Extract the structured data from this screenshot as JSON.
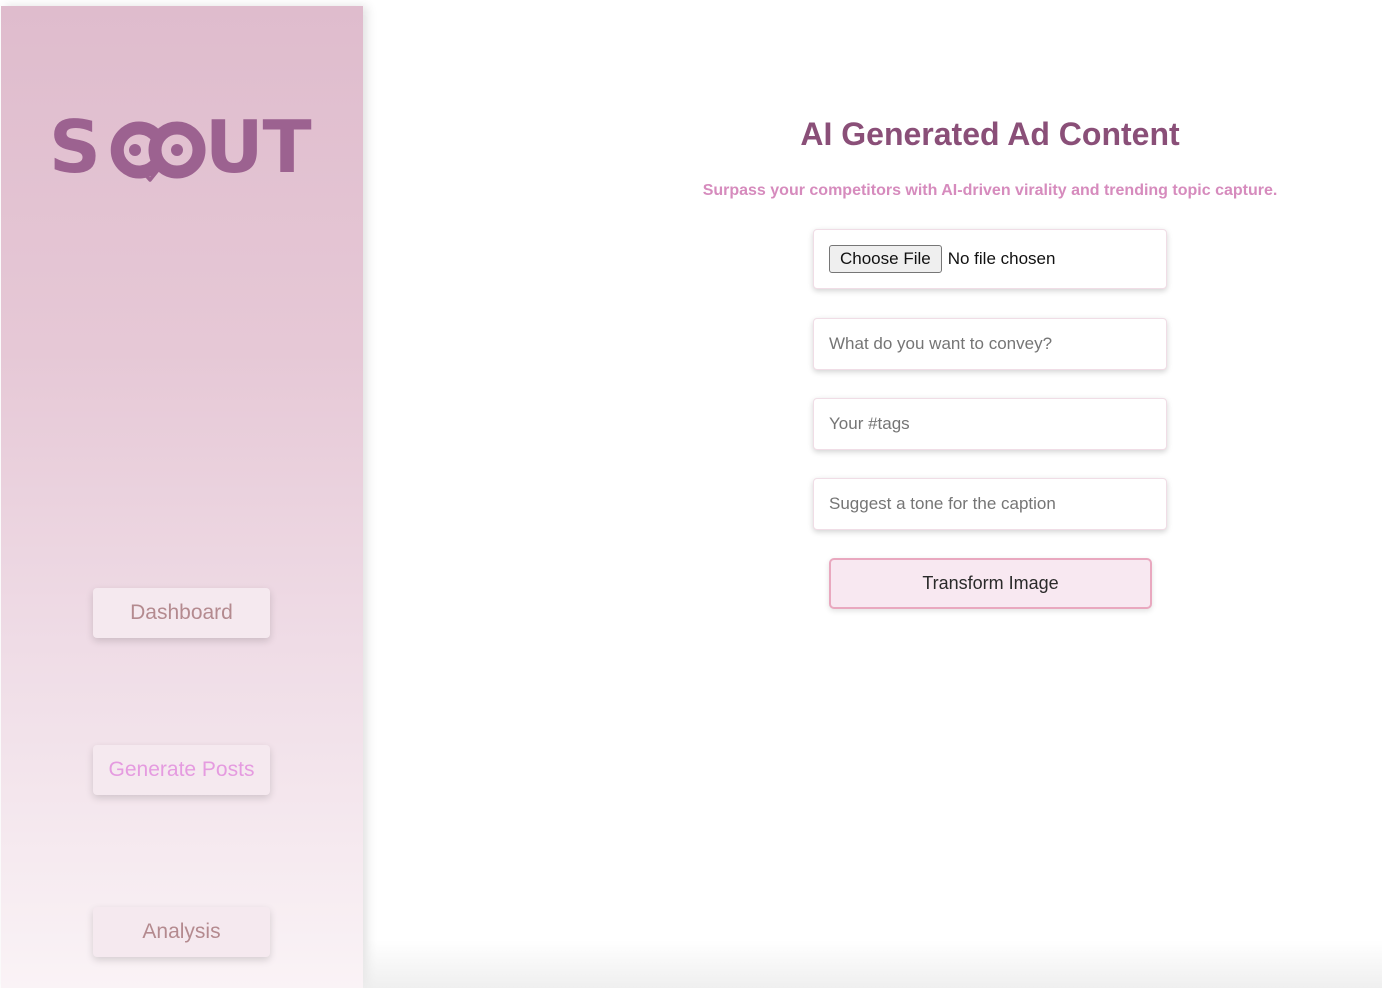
{
  "brand": {
    "logo_text": "SCOUT"
  },
  "sidebar": {
    "items": [
      {
        "label": "Dashboard",
        "active": false
      },
      {
        "label": "Generate Posts",
        "active": true
      },
      {
        "label": "Analysis",
        "active": false
      }
    ]
  },
  "main": {
    "title": "AI Generated Ad Content",
    "subtitle": "Surpass your competitors with AI-driven virality and trending topic capture.",
    "file_input": {
      "button_label": "Choose File",
      "status": "No file chosen"
    },
    "convey_input": {
      "placeholder": "What do you want to convey?",
      "value": ""
    },
    "tags_input": {
      "placeholder": "Your #tags",
      "value": ""
    },
    "tone_input": {
      "placeholder": "Suggest a tone for the caption",
      "value": ""
    },
    "submit_label": "Transform Image"
  },
  "colors": {
    "brand": "#9c6290",
    "title": "#8a4f78",
    "subtitle": "#d68bbd",
    "nav_text": "#b48a8f",
    "nav_active": "#e59be0",
    "button_border": "#e9a8bf"
  }
}
